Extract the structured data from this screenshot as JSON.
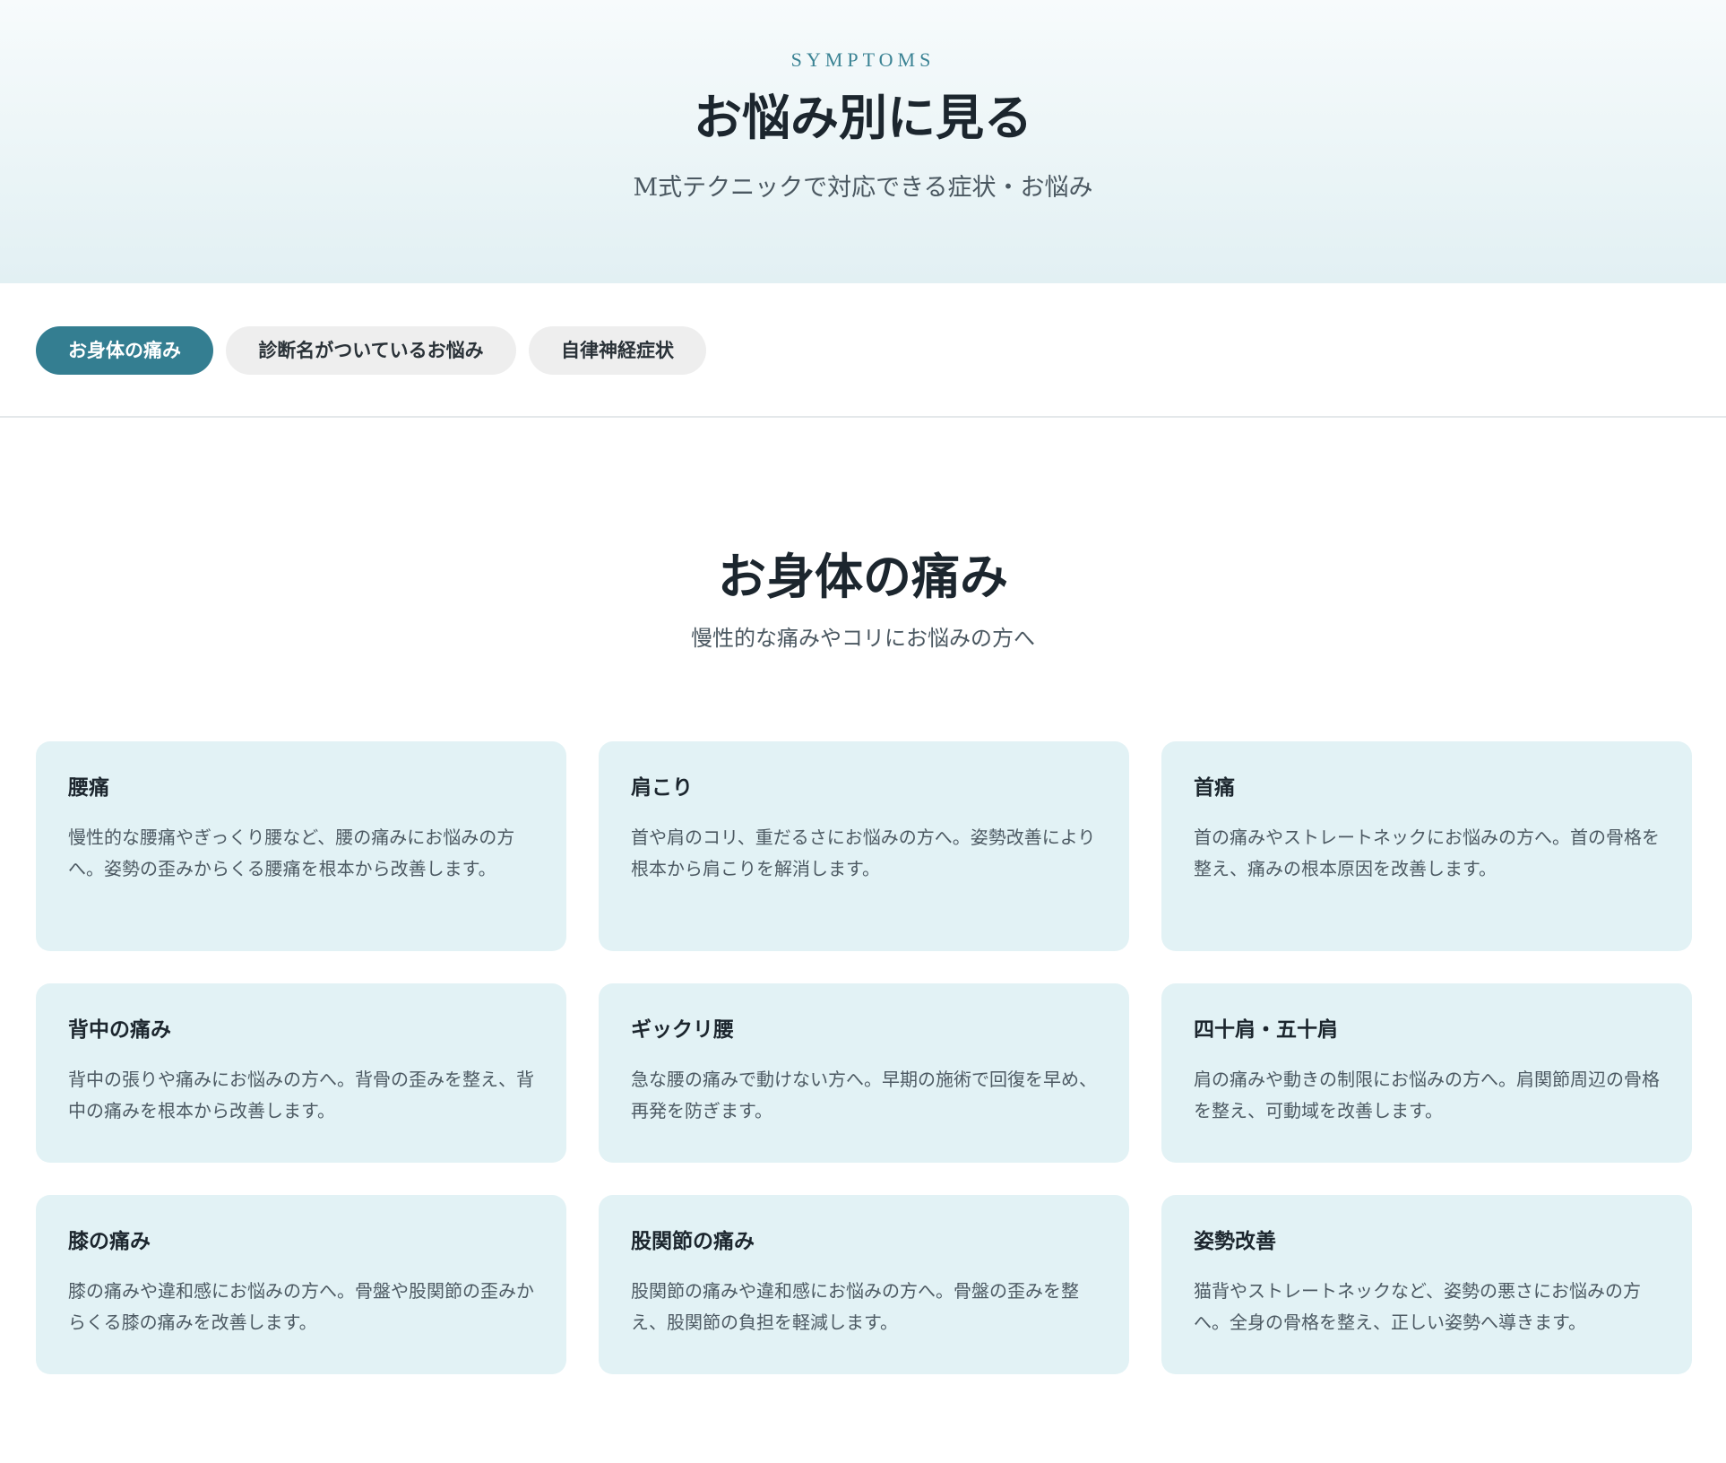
{
  "hero": {
    "eyebrow": "SYMPTOMS",
    "title": "お悩み別に見る",
    "subtitle": "M式テクニックで対応できる症状・お悩み"
  },
  "tabs": [
    {
      "label": "お身体の痛み",
      "active": true
    },
    {
      "label": "診断名がついているお悩み",
      "active": false
    },
    {
      "label": "自律神経症状",
      "active": false
    }
  ],
  "section": {
    "title": "お身体の痛み",
    "subtitle": "慢性的な痛みやコリにお悩みの方へ"
  },
  "cards": [
    {
      "title": "腰痛",
      "body": "慢性的な腰痛やぎっくり腰など、腰の痛みにお悩みの方へ。姿勢の歪みからくる腰痛を根本から改善します。"
    },
    {
      "title": "肩こり",
      "body": "首や肩のコリ、重だるさにお悩みの方へ。姿勢改善により根本から肩こりを解消します。"
    },
    {
      "title": "首痛",
      "body": "首の痛みやストレートネックにお悩みの方へ。首の骨格を整え、痛みの根本原因を改善します。"
    },
    {
      "title": "背中の痛み",
      "body": "背中の張りや痛みにお悩みの方へ。背骨の歪みを整え、背中の痛みを根本から改善します。"
    },
    {
      "title": "ギックリ腰",
      "body": "急な腰の痛みで動けない方へ。早期の施術で回復を早め、再発を防ぎます。"
    },
    {
      "title": "四十肩・五十肩",
      "body": "肩の痛みや動きの制限にお悩みの方へ。肩関節周辺の骨格を整え、可動域を改善します。"
    },
    {
      "title": "膝の痛み",
      "body": "膝の痛みや違和感にお悩みの方へ。骨盤や股関節の歪みからくる膝の痛みを改善します。"
    },
    {
      "title": "股関節の痛み",
      "body": "股関節の痛みや違和感にお悩みの方へ。骨盤の歪みを整え、股関節の負担を軽減します。"
    },
    {
      "title": "姿勢改善",
      "body": "猫背やストレートネックなど、姿勢の悪さにお悩みの方へ。全身の骨格を整え、正しい姿勢へ導きます。"
    }
  ],
  "colors": {
    "accent": "#347e91",
    "card_bg": "#e2f2f5",
    "eyebrow": "#3b8394"
  }
}
